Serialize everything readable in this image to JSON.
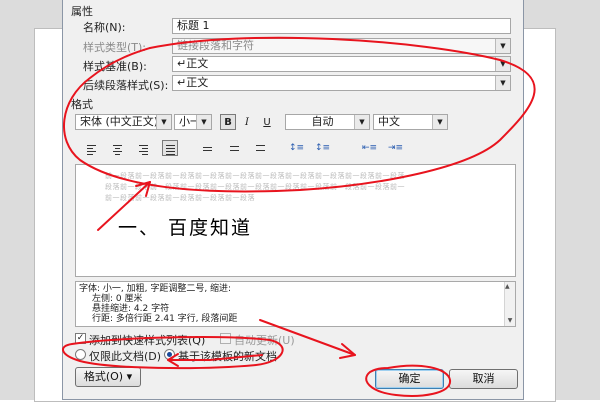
{
  "dialog": {
    "section_properties": "属性",
    "section_format": "格式",
    "name_label": "名称(N):",
    "name_value": "标题 1",
    "type_label": "样式类型(T):",
    "type_value": "链接段落和字符",
    "based_label": "样式基准(B):",
    "based_value": "↵正文",
    "next_label": "后续段落样式(S):",
    "next_value": "↵正文"
  },
  "toolbar": {
    "font": "宋体 (中文正文)",
    "size": "小一",
    "bold": "B",
    "italic": "I",
    "underline": "U",
    "color": "自动",
    "language": "中文"
  },
  "preview": {
    "prev_line_1": "前一段落前一段落前一段落前一段落前一段落前一段落前一段落前一段落前一段落前一段落",
    "prev_line_2": "段落前一段落前一段落前一段落前一段落前一段落前一段落前一段落前一段落前一段落前一",
    "prev_line_3": "前一段落前一段落前一段落前一段落前一段落",
    "heading": "一、 百度知道"
  },
  "description": {
    "line1": "字体: 小一, 加粗, 字距调整二号, 缩进:",
    "line2": "左侧:  0 厘米",
    "line3": "悬挂缩进: 4.2 字符",
    "line4": "行距: 多倍行距 2.41 字行, 段落间距"
  },
  "options": {
    "add_quick_list": "添加到快速样式列表(Q)",
    "auto_update": "自动更新(U)",
    "only_this_doc": "仅限此文档(D)",
    "template_docs": "基于该模板的新文档",
    "add_quick_list_checked": true,
    "auto_update_checked": false,
    "selected_scope": "template_docs"
  },
  "buttons": {
    "format": "格式(O) ▾",
    "ok": "确定",
    "cancel": "取消"
  },
  "colors": {
    "annotation_red": "#e8141e",
    "dialog_bg": "#f0f0f0"
  }
}
